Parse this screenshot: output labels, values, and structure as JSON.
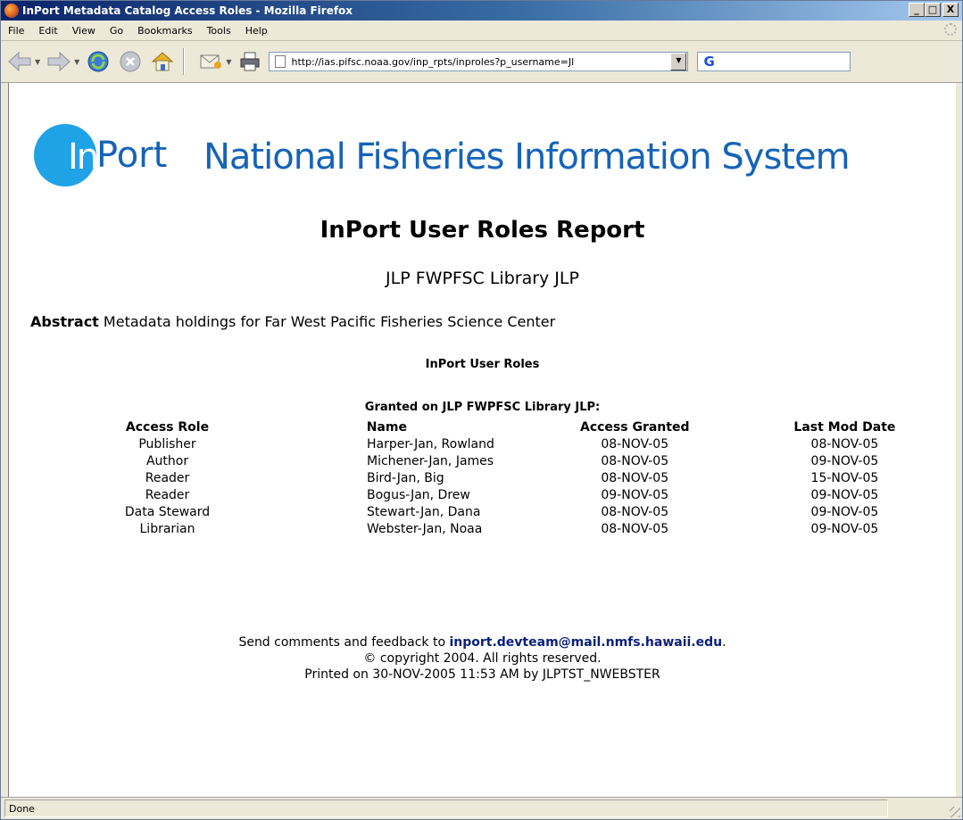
{
  "window": {
    "title": "InPort Metadata Catalog Access Roles - Mozilla Firefox",
    "minimize_label": "_",
    "maximize_label": "□",
    "close_label": "X"
  },
  "menu": {
    "items": [
      "File",
      "Edit",
      "View",
      "Go",
      "Bookmarks",
      "Tools",
      "Help"
    ]
  },
  "toolbar": {
    "url": "http://ias.pifsc.noaa.gov/inp_rpts/inproles?p_username=Jl",
    "search_icon": "G"
  },
  "page": {
    "logo_in": "In",
    "logo_port": "Port",
    "logo_tagline": "National Fisheries Information System",
    "report_title": "InPort User Roles Report",
    "report_subtitle": "JLP FWPFSC Library JLP",
    "abstract_label": "Abstract",
    "abstract_text": " Metadata holdings for Far West Pacific Fisheries Science Center",
    "roles_heading": "InPort User Roles",
    "granted_heading": "Granted on JLP FWPFSC Library JLP:",
    "table": {
      "headers": [
        "Access Role",
        "Name",
        "Access Granted",
        "Last Mod Date"
      ],
      "rows": [
        [
          "Publisher",
          "Harper-Jan, Rowland",
          "08-NOV-05",
          "08-NOV-05"
        ],
        [
          "Author",
          "Michener-Jan, James",
          "08-NOV-05",
          "09-NOV-05"
        ],
        [
          "Reader",
          "Bird-Jan, Big",
          "08-NOV-05",
          "15-NOV-05"
        ],
        [
          "Reader",
          "Bogus-Jan, Drew",
          "09-NOV-05",
          "09-NOV-05"
        ],
        [
          "Data Steward",
          "Stewart-Jan, Dana",
          "08-NOV-05",
          "09-NOV-05"
        ],
        [
          "Librarian",
          "Webster-Jan, Noaa",
          "08-NOV-05",
          "09-NOV-05"
        ]
      ]
    },
    "footer": {
      "comments_prefix": "Send comments and feedback to ",
      "email": "inport.devteam@mail.nmfs.hawaii.edu",
      "comments_suffix": ".",
      "copyright": "© copyright 2004. All rights reserved.",
      "printed": "Printed on 30-NOV-2005 11:53 AM by JLPTST_NWEBSTER"
    }
  },
  "status": {
    "text": "Done"
  },
  "colors": {
    "title_bar": "#0a246a",
    "logo_circle": "#1fa3e6",
    "logo_text": "#1563b8",
    "link": "#0a1f7a"
  }
}
